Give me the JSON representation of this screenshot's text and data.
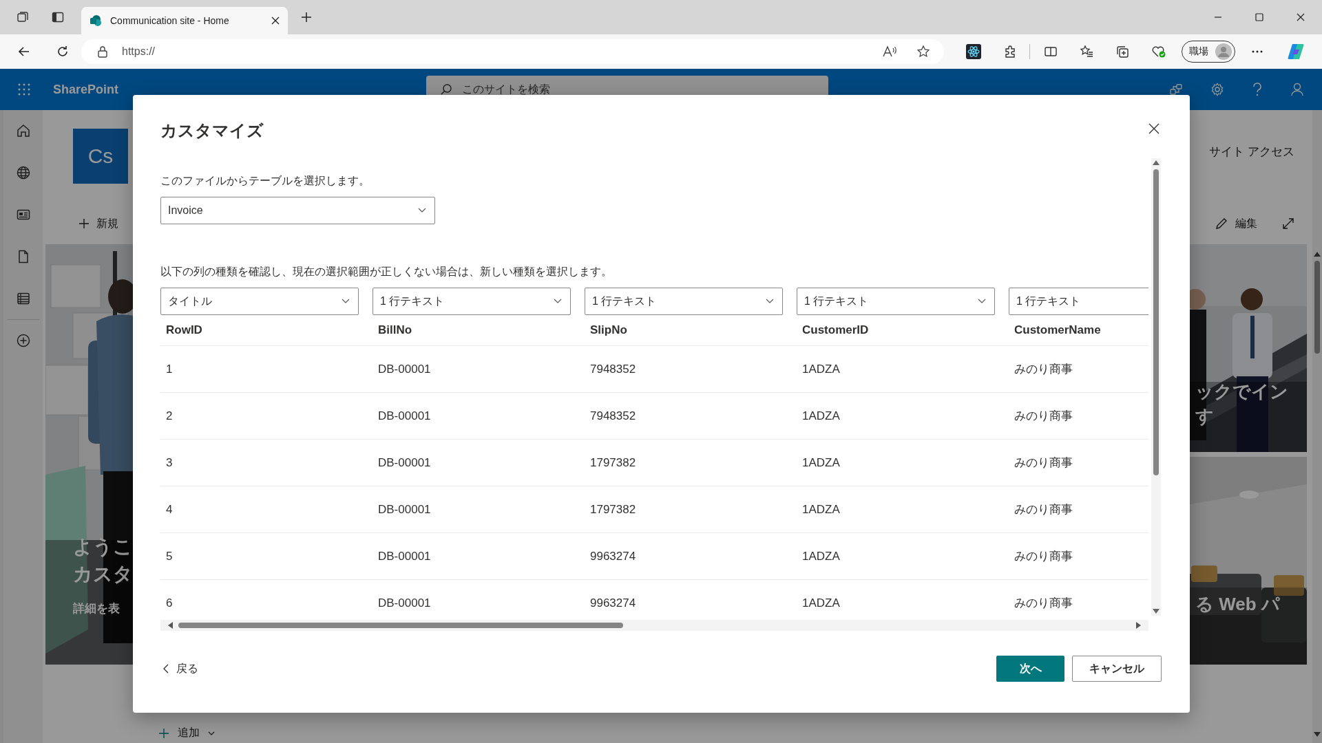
{
  "browser": {
    "tabs": [
      {
        "title": "Communication site - Home",
        "selected": true
      }
    ],
    "address": "https://",
    "profile": "職場"
  },
  "suite_bar": {
    "app_name": "SharePoint",
    "search_placeholder": "このサイトを検索"
  },
  "page": {
    "logo": "Cs",
    "new_button": "新規",
    "site_access": "サイト アクセス",
    "edit_button": "編集",
    "add_button": "追加",
    "hero_main": {
      "headline": [
        "ようこ",
        "カスタ"
      ],
      "subtitle": "詳細を表"
    },
    "hero_tiles": [
      {
        "lines": [
          "ックでイン",
          "す"
        ]
      },
      {
        "lines": [
          "る Web パ"
        ]
      }
    ]
  },
  "dialog": {
    "title": "カスタマイズ",
    "table_label": "このファイルからテーブルを選択します。",
    "table_select": "Invoice",
    "instruction": "以下の列の種類を確認し、現在の選択範囲が正しくない場合は、新しい種類を選択します。",
    "column_types": [
      "タイトル",
      "1 行テキスト",
      "1 行テキスト",
      "1 行テキスト",
      "1 行テキスト"
    ],
    "table": {
      "columns": [
        "RowID",
        "BillNo",
        "SlipNo",
        "CustomerID",
        "CustomerName"
      ],
      "rows": [
        [
          "1",
          "DB-00001",
          "7948352",
          "1ADZA",
          "みのり商事"
        ],
        [
          "2",
          "DB-00001",
          "7948352",
          "1ADZA",
          "みのり商事"
        ],
        [
          "3",
          "DB-00001",
          "1797382",
          "1ADZA",
          "みのり商事"
        ],
        [
          "4",
          "DB-00001",
          "1797382",
          "1ADZA",
          "みのり商事"
        ],
        [
          "5",
          "DB-00001",
          "9963274",
          "1ADZA",
          "みのり商事"
        ],
        [
          "6",
          "DB-00001",
          "9963274",
          "1ADZA",
          "みのり商事"
        ]
      ]
    },
    "back_link": "戻る",
    "next_button": "次へ",
    "cancel_button": "キャンセル"
  }
}
